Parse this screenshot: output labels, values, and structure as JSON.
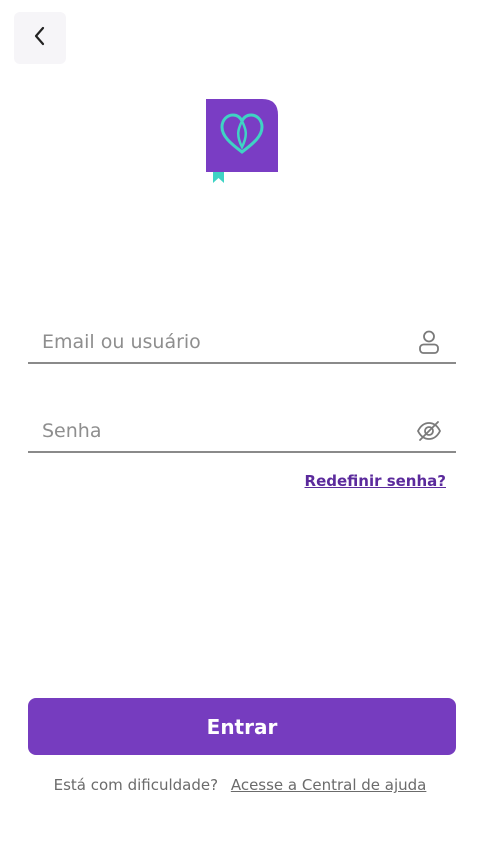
{
  "colors": {
    "brand_purple": "#763cbf",
    "logo_purple": "#7a3dc4",
    "logo_accent": "#3fd3c4",
    "link_purple": "#5b2a9c"
  },
  "header": {
    "back_icon": "chevron-left-icon"
  },
  "login_form": {
    "email_placeholder": "Email ou usuário",
    "email_icon": "user-icon",
    "password_placeholder": "Senha",
    "password_icon": "eye-slash-icon",
    "reset_password_label": "Redefinir senha?"
  },
  "actions": {
    "submit_label": "Entrar"
  },
  "help": {
    "prompt": "Está com dificuldade?",
    "link_label": "Acesse a Central de ajuda"
  }
}
